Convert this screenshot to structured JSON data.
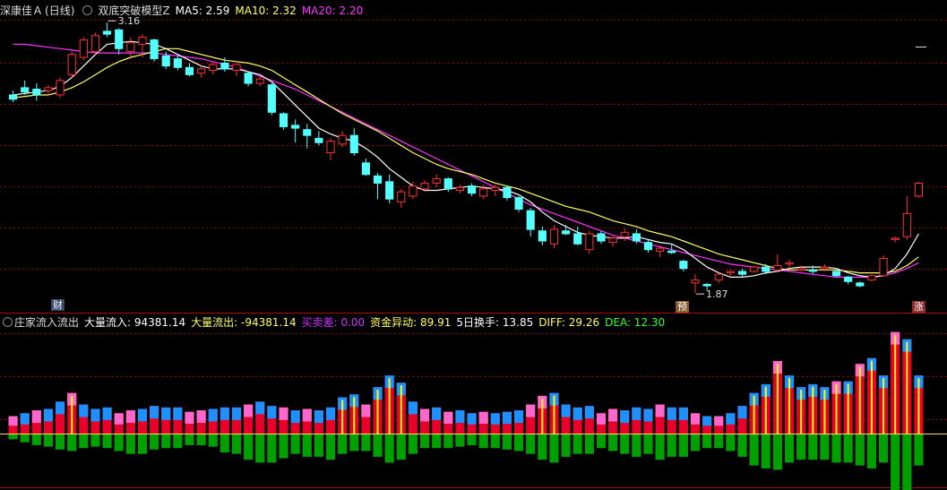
{
  "header_main": {
    "stock_name": "深康佳Ａ",
    "period": "(日线)",
    "indicator": "双底突破模型Z",
    "ma5_label": "MA5: 2.59",
    "ma10_label": "MA10: 2.32",
    "ma20_label": "MA20: 2.20"
  },
  "header_sub": {
    "indicator": "庄家流入流出",
    "big_in": "大量流入: 94381.14",
    "big_out": "大量流出: -94381.14",
    "buy_sell_diff": "买卖差: 0.00",
    "fund_anomaly": "资金异动: 89.91",
    "turnover5": "5日换手: 13.85",
    "diff": "DIFF: 29.26",
    "dea": "DEA: 12.30"
  },
  "markers": {
    "cai": "财",
    "yu": "预",
    "zhang": "涨",
    "high_label": "3.16",
    "low_label": "1.87"
  },
  "colors": {
    "up": "#ff3232",
    "down": "#54ffff",
    "ma5": "#ffffff",
    "ma10": "#ffff66",
    "ma20": "#ff33ff",
    "grid": "#7a1010",
    "inflow": "#e8002a",
    "outflow": "#00a000"
  },
  "chart_data": {
    "type": "candlestick",
    "price_range": [
      1.75,
      3.4
    ],
    "candles": [
      [
        2.7,
        2.73,
        2.65,
        2.67
      ],
      [
        2.75,
        2.8,
        2.7,
        2.72
      ],
      [
        2.74,
        2.78,
        2.66,
        2.7
      ],
      [
        2.73,
        2.77,
        2.69,
        2.75
      ],
      [
        2.7,
        2.82,
        2.68,
        2.8
      ],
      [
        2.84,
        3.0,
        2.82,
        2.98
      ],
      [
        2.96,
        3.1,
        2.94,
        3.08
      ],
      [
        3.0,
        3.13,
        2.98,
        3.11
      ],
      [
        3.14,
        3.2,
        3.1,
        3.12
      ],
      [
        3.15,
        3.16,
        2.98,
        3.02
      ],
      [
        3.0,
        3.1,
        2.96,
        3.06
      ],
      [
        3.05,
        3.12,
        2.96,
        3.1
      ],
      [
        3.08,
        3.09,
        2.93,
        2.95
      ],
      [
        2.97,
        3.0,
        2.88,
        2.9
      ],
      [
        2.95,
        2.97,
        2.87,
        2.89
      ],
      [
        2.89,
        2.92,
        2.83,
        2.84
      ],
      [
        2.85,
        2.9,
        2.82,
        2.88
      ],
      [
        2.87,
        2.93,
        2.84,
        2.91
      ],
      [
        2.92,
        2.96,
        2.86,
        2.88
      ],
      [
        2.87,
        2.92,
        2.83,
        2.91
      ],
      [
        2.85,
        2.86,
        2.76,
        2.78
      ],
      [
        2.78,
        2.83,
        2.76,
        2.81
      ],
      [
        2.77,
        2.78,
        2.56,
        2.58
      ],
      [
        2.57,
        2.58,
        2.46,
        2.48
      ],
      [
        2.49,
        2.53,
        2.37,
        2.47
      ],
      [
        2.46,
        2.5,
        2.33,
        2.42
      ],
      [
        2.4,
        2.45,
        2.35,
        2.37
      ],
      [
        2.3,
        2.4,
        2.25,
        2.38
      ],
      [
        2.36,
        2.45,
        2.34,
        2.42
      ],
      [
        2.42,
        2.47,
        2.28,
        2.3
      ],
      [
        2.23,
        2.26,
        2.14,
        2.15
      ],
      [
        2.14,
        2.16,
        1.98,
        2.09
      ],
      [
        2.1,
        2.15,
        1.95,
        1.98
      ],
      [
        1.96,
        2.05,
        1.92,
        2.03
      ],
      [
        2.0,
        2.1,
        1.98,
        2.07
      ],
      [
        2.05,
        2.11,
        2.03,
        2.09
      ],
      [
        2.09,
        2.15,
        2.06,
        2.12
      ],
      [
        2.12,
        2.13,
        2.03,
        2.05
      ],
      [
        2.04,
        2.08,
        2.02,
        2.06
      ],
      [
        2.07,
        2.09,
        2.0,
        2.02
      ],
      [
        2.0,
        2.08,
        1.98,
        2.05
      ],
      [
        2.04,
        2.08,
        2.0,
        2.06
      ],
      [
        2.06,
        2.07,
        1.97,
        1.99
      ],
      [
        1.99,
        2.0,
        1.89,
        1.91
      ],
      [
        1.9,
        1.92,
        1.72,
        1.77
      ],
      [
        1.76,
        1.79,
        1.66,
        1.69
      ],
      [
        1.67,
        1.8,
        1.64,
        1.77
      ],
      [
        1.76,
        1.8,
        1.73,
        1.74
      ],
      [
        1.74,
        1.79,
        1.66,
        1.67
      ],
      [
        1.63,
        1.76,
        1.6,
        1.74
      ],
      [
        1.74,
        1.76,
        1.67,
        1.69
      ],
      [
        1.68,
        1.73,
        1.65,
        1.71
      ],
      [
        1.72,
        1.78,
        1.69,
        1.75
      ],
      [
        1.74,
        1.77,
        1.67,
        1.69
      ],
      [
        1.68,
        1.7,
        1.61,
        1.63
      ],
      [
        1.62,
        1.66,
        1.58,
        1.64
      ],
      [
        1.62,
        1.67,
        1.6,
        1.61
      ],
      [
        1.55,
        1.56,
        1.48,
        1.5
      ],
      [
        1.4,
        1.46,
        1.33,
        1.42
      ],
      [
        1.39,
        1.4,
        1.35,
        1.38
      ],
      [
        1.42,
        1.47,
        1.4,
        1.46
      ],
      [
        1.47,
        1.49,
        1.45,
        1.48
      ],
      [
        1.48,
        1.5,
        1.44,
        1.46
      ],
      [
        1.48,
        1.52,
        1.47,
        1.51
      ],
      [
        1.51,
        1.53,
        1.46,
        1.48
      ],
      [
        1.49,
        1.6,
        1.48,
        1.52
      ],
      [
        1.53,
        1.56,
        1.5,
        1.54
      ],
      [
        1.49,
        1.52,
        1.48,
        1.5
      ],
      [
        1.49,
        1.52,
        1.46,
        1.48
      ],
      [
        1.5,
        1.53,
        1.48,
        1.51
      ],
      [
        1.48,
        1.49,
        1.44,
        1.45
      ],
      [
        1.44,
        1.45,
        1.39,
        1.41
      ],
      [
        1.4,
        1.41,
        1.37,
        1.38
      ],
      [
        1.42,
        1.46,
        1.41,
        1.45
      ],
      [
        1.45,
        1.59,
        1.44,
        1.57
      ],
      [
        1.7,
        1.72,
        1.68,
        1.71
      ],
      [
        1.72,
        2.0,
        1.7,
        1.88
      ],
      [
        2.0,
        2.1,
        1.99,
        2.09
      ]
    ],
    "ma5": [
      2.7,
      2.71,
      2.72,
      2.73,
      2.76,
      2.82,
      2.9,
      2.98,
      3.05,
      3.06,
      3.07,
      3.06,
      3.05,
      3.02,
      2.98,
      2.94,
      2.9,
      2.88,
      2.88,
      2.88,
      2.86,
      2.84,
      2.79,
      2.71,
      2.63,
      2.55,
      2.47,
      2.43,
      2.4,
      2.38,
      2.33,
      2.27,
      2.19,
      2.13,
      2.07,
      2.04,
      2.04,
      2.05,
      2.06,
      2.07,
      2.06,
      2.05,
      2.04,
      2.01,
      1.96,
      1.89,
      1.83,
      1.79,
      1.75,
      1.73,
      1.72,
      1.71,
      1.71,
      1.72,
      1.7,
      1.68,
      1.67,
      1.63,
      1.57,
      1.51,
      1.47,
      1.44,
      1.44,
      1.45,
      1.47,
      1.48,
      1.5,
      1.51,
      1.51,
      1.51,
      1.5,
      1.47,
      1.45,
      1.44,
      1.45,
      1.5,
      1.6,
      1.74
    ],
    "ma10": [
      2.68,
      2.69,
      2.7,
      2.7,
      2.72,
      2.75,
      2.79,
      2.84,
      2.89,
      2.93,
      2.96,
      2.98,
      3.0,
      3.02,
      3.02,
      3.0,
      2.98,
      2.96,
      2.94,
      2.93,
      2.92,
      2.9,
      2.87,
      2.82,
      2.77,
      2.72,
      2.67,
      2.62,
      2.57,
      2.53,
      2.49,
      2.45,
      2.4,
      2.35,
      2.3,
      2.26,
      2.22,
      2.19,
      2.17,
      2.15,
      2.12,
      2.09,
      2.07,
      2.05,
      2.02,
      1.99,
      1.96,
      1.93,
      1.91,
      1.89,
      1.86,
      1.83,
      1.81,
      1.79,
      1.76,
      1.74,
      1.72,
      1.69,
      1.66,
      1.63,
      1.6,
      1.58,
      1.56,
      1.54,
      1.52,
      1.5,
      1.49,
      1.49,
      1.49,
      1.49,
      1.49,
      1.48,
      1.47,
      1.47,
      1.47,
      1.48,
      1.52,
      1.58
    ],
    "ma20": [
      3.05,
      3.05,
      3.04,
      3.03,
      3.02,
      3.01,
      3.0,
      2.99,
      2.99,
      2.99,
      2.99,
      2.99,
      2.99,
      2.98,
      2.97,
      2.96,
      2.95,
      2.93,
      2.91,
      2.89,
      2.86,
      2.83,
      2.8,
      2.77,
      2.74,
      2.7,
      2.66,
      2.62,
      2.58,
      2.54,
      2.5,
      2.46,
      2.42,
      2.38,
      2.34,
      2.3,
      2.26,
      2.22,
      2.18,
      2.14,
      2.1,
      2.06,
      2.02,
      1.98,
      1.94,
      1.91,
      1.88,
      1.85,
      1.82,
      1.79,
      1.76,
      1.73,
      1.71,
      1.69,
      1.67,
      1.65,
      1.63,
      1.61,
      1.59,
      1.57,
      1.55,
      1.53,
      1.52,
      1.51,
      1.5,
      1.49,
      1.48,
      1.47,
      1.46,
      1.45,
      1.44,
      1.44,
      1.44,
      1.44,
      1.45,
      1.47,
      1.5,
      1.54
    ],
    "inflow": [
      12,
      14,
      16,
      17,
      22,
      28,
      20,
      17,
      18,
      14,
      16,
      17,
      19,
      18,
      18,
      15,
      16,
      17,
      18,
      18,
      20,
      22,
      19,
      18,
      16,
      17,
      16,
      18,
      25,
      27,
      20,
      32,
      40,
      35,
      22,
      17,
      18,
      15,
      16,
      14,
      15,
      14,
      15,
      16,
      20,
      26,
      28,
      20,
      18,
      19,
      14,
      17,
      16,
      18,
      17,
      20,
      18,
      18,
      14,
      12,
      12,
      14,
      19,
      28,
      34,
      50,
      40,
      32,
      34,
      32,
      36,
      36,
      48,
      52,
      40,
      70,
      65,
      40
    ],
    "outflow": [
      -4,
      -6,
      -8,
      -9,
      -11,
      -12,
      -10,
      -9,
      -10,
      -12,
      -14,
      -14,
      -11,
      -10,
      -10,
      -8,
      -8,
      -9,
      -13,
      -14,
      -18,
      -20,
      -20,
      -17,
      -14,
      -16,
      -16,
      -18,
      -14,
      -12,
      -12,
      -16,
      -20,
      -18,
      -14,
      -10,
      -10,
      -10,
      -9,
      -8,
      -10,
      -10,
      -11,
      -12,
      -14,
      -18,
      -20,
      -16,
      -14,
      -14,
      -10,
      -12,
      -14,
      -16,
      -14,
      -18,
      -16,
      -16,
      -12,
      -10,
      -10,
      -12,
      -16,
      -22,
      -24,
      -25,
      -20,
      -18,
      -18,
      -18,
      -20,
      -20,
      -22,
      -24,
      -20,
      -40,
      -45,
      -22
    ]
  }
}
